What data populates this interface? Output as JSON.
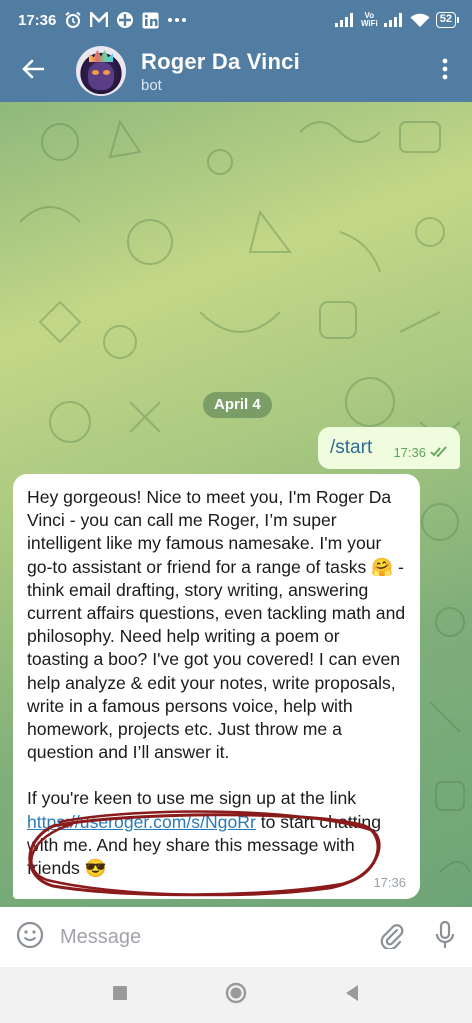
{
  "status_bar": {
    "time": "17:36",
    "network_label_top": "Vo",
    "network_label_bottom": "WiFi",
    "battery": "52"
  },
  "header": {
    "title": "Roger Da Vinci",
    "subtitle": "bot"
  },
  "chat": {
    "date_label": "April 4",
    "outgoing": {
      "text": "/start",
      "time": "17:36"
    },
    "incoming": {
      "paragraph1": "Hey gorgeous! Nice to meet you, I'm Roger Da Vinci - you can call me Roger, I’m super intelligent like my famous namesake. I'm your go-to assistant or friend for a range of tasks 🤗 - think email drafting, story writing, answering current affairs questions, even tackling math and philosophy. Need help writing a poem or toasting a boo? I've got you covered! I can even help analyze & edit your notes, write proposals, write in a famous persons voice, help with homework, projects etc. Just throw me a question and I’ll answer it.",
      "paragraph2_before": "If you're keen to use me sign up at the link ",
      "link": "https://useroger.com/s/NgoRr",
      "paragraph2_after": " to start chatting with me. And hey share this message with friends 😎",
      "time": "17:36"
    }
  },
  "input": {
    "placeholder": "Message"
  },
  "colors": {
    "header_bg": "#517da2",
    "outgoing_bubble": "#effdde",
    "link": "#2a7ab7",
    "annotation": "#8b1a1a"
  },
  "icons": [
    "alarm-icon",
    "m-app-icon",
    "app-icon",
    "linkedin-icon",
    "more-dots-icon",
    "signal-icon",
    "wifi-icon",
    "battery-icon",
    "back-arrow-icon",
    "kebab-menu-icon",
    "double-check-icon",
    "emoji-icon",
    "paperclip-icon",
    "microphone-icon",
    "nav-recents-icon",
    "nav-home-icon",
    "nav-back-icon"
  ]
}
